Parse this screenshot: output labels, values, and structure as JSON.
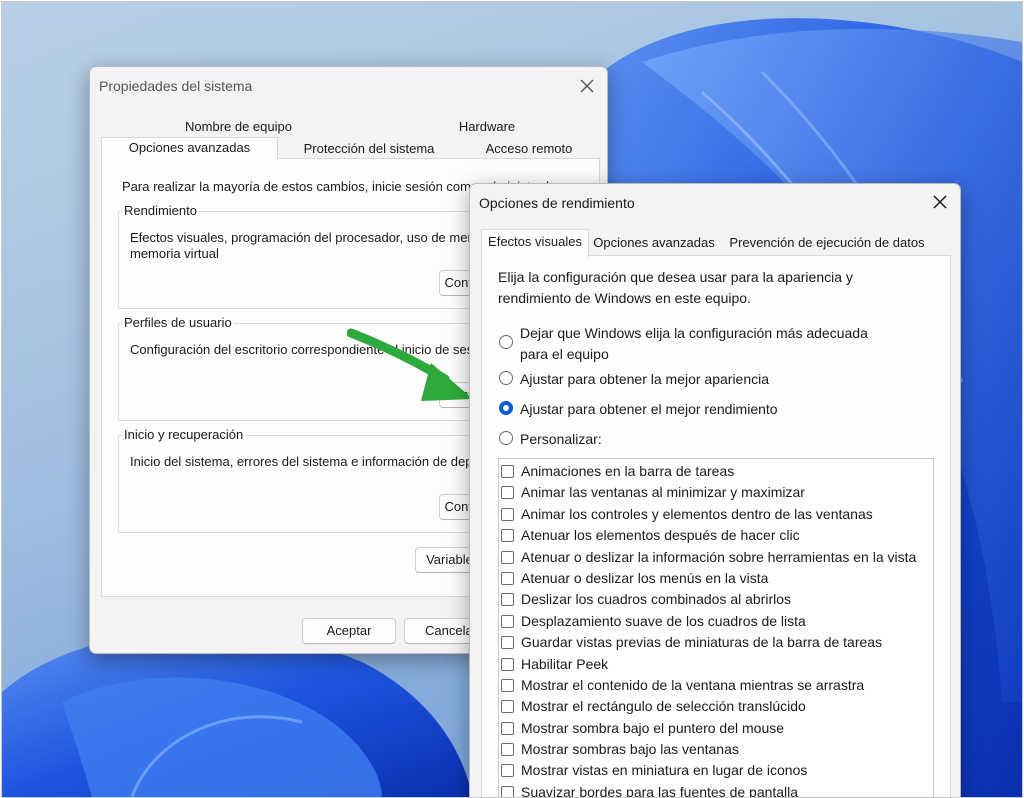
{
  "sys_window": {
    "title": "Propiedades del sistema",
    "tabs_top": [
      "Nombre de equipo",
      "Hardware"
    ],
    "tabs_bottom": [
      "Opciones avanzadas",
      "Protección del sistema",
      "Acceso remoto"
    ],
    "admin_note": "Para realizar la mayoría de estos cambios, inicie sesión como administrador.",
    "groups": [
      {
        "title": "Rendimiento",
        "desc_line1": "Efectos visuales, programación del procesador, uso de memoria y",
        "desc_line2": "memoria virtual",
        "button": "Configuración..."
      },
      {
        "title": "Perfiles de usuario",
        "desc_line1": "Configuración del escritorio correspondiente al inicio de sesión",
        "button": "Configuración..."
      },
      {
        "title": "Inicio y recuperación",
        "desc_line1": "Inicio del sistema, errores del sistema e información de depuración",
        "button": "Configuración..."
      }
    ],
    "env_button": "Variables de entorno...",
    "ok_button": "Aceptar",
    "cancel_button": "Cancelar"
  },
  "perf_window": {
    "title": "Opciones de rendimiento",
    "tabs": [
      "Efectos visuales",
      "Opciones avanzadas",
      "Prevención de ejecución de datos"
    ],
    "intro_line1": "Elija la configuración que desea usar para la apariencia y",
    "intro_line2": "rendimiento de Windows en este equipo.",
    "options": [
      {
        "line1": "Dejar que Windows elija la configuración más adecuada",
        "line2": "para el equipo",
        "selected": false
      },
      {
        "line1": "Ajustar para obtener la mejor apariencia",
        "selected": false
      },
      {
        "line1": "Ajustar para obtener el mejor rendimiento",
        "selected": true
      },
      {
        "line1": "Personalizar:",
        "selected": false
      }
    ],
    "effects": [
      "Animaciones en la barra de tareas",
      "Animar las ventanas al minimizar y maximizar",
      "Animar los controles y elementos dentro de las ventanas",
      "Atenuar los elementos después de hacer clic",
      "Atenuar o deslizar la información sobre herramientas en la vista",
      "Atenuar o deslizar los menús en la vista",
      "Deslizar los cuadros combinados al abrirlos",
      "Desplazamiento suave de los cuadros de lista",
      "Guardar vistas previas de miniaturas de la barra de tareas",
      "Habilitar Peek",
      "Mostrar el contenido de la ventana mientras se arrastra",
      "Mostrar el rectángulo de selección translúcido",
      "Mostrar sombra bajo el puntero del mouse",
      "Mostrar sombras bajo las ventanas",
      "Mostrar vistas en miniatura en lugar de iconos",
      "Suavizar bordes para las fuentes de pantalla"
    ]
  },
  "colors": {
    "accent": "#0a5bd0",
    "arrow": "#2eaa3c",
    "wallpaper_blue": "#1f5fe0"
  }
}
